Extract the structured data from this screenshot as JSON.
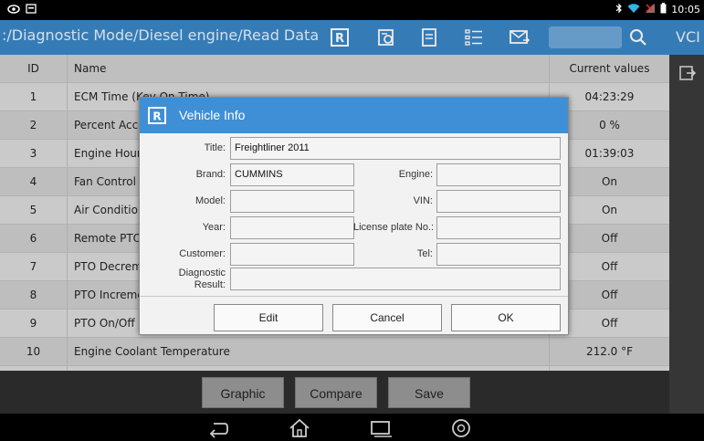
{
  "statusbar": {
    "left_icons": [
      "eye-icon",
      "screen-icon"
    ],
    "right_icons": [
      "bluetooth-icon",
      "wifi-icon",
      "signal-off-icon",
      "battery-icon"
    ],
    "time": "10:05"
  },
  "toolbar": {
    "path": ":/Diagnostic Mode/Diesel engine/Read Data Stre:",
    "icons": [
      "report-icon",
      "camera-icon",
      "save-file-icon",
      "list-icon",
      "mail-icon"
    ],
    "search_value": "",
    "vci_label": "VCI"
  },
  "table": {
    "headers": {
      "id": "ID",
      "name": "Name",
      "value": "Current values"
    },
    "rows": [
      {
        "id": "1",
        "name": "ECM Time (Key On Time)",
        "value": "04:23:29"
      },
      {
        "id": "2",
        "name": "Percent Acce",
        "value": "0 %"
      },
      {
        "id": "3",
        "name": "Engine Hours",
        "value": "01:39:03"
      },
      {
        "id": "4",
        "name": "Fan Control S",
        "value": "On"
      },
      {
        "id": "5",
        "name": "Air Conditioni",
        "value": "On"
      },
      {
        "id": "6",
        "name": "Remote PTO",
        "value": "Off"
      },
      {
        "id": "7",
        "name": "PTO Decrem",
        "value": "Off"
      },
      {
        "id": "8",
        "name": "PTO Increme",
        "value": "Off"
      },
      {
        "id": "9",
        "name": "PTO On/Off S",
        "value": "Off"
      },
      {
        "id": "10",
        "name": "Engine Coolant Temperature",
        "value": "212.0 °F"
      },
      {
        "id": "",
        "name": "",
        "value": ""
      }
    ]
  },
  "bottom_buttons": {
    "graphic": "Graphic",
    "compare": "Compare",
    "save": "Save"
  },
  "dialog": {
    "title": "Vehicle Info",
    "labels": {
      "title": "Title:",
      "brand": "Brand:",
      "engine": "Engine:",
      "model": "Model:",
      "vin": "VIN:",
      "year": "Year:",
      "license": "License plate No.:",
      "customer": "Customer:",
      "tel": "Tel:",
      "diagnostic": "Diagnostic",
      "diagnostic2": "Result:"
    },
    "values": {
      "title": "Freightliner 2011",
      "brand": "CUMMINS",
      "engine": "",
      "model": "",
      "vin": "",
      "year": "",
      "license": "",
      "customer": "",
      "tel": "",
      "diagnostic": ""
    },
    "buttons": {
      "edit": "Edit",
      "cancel": "Cancel",
      "ok": "OK"
    }
  },
  "colors": {
    "toolbar": "#3a87c7",
    "dialog_header": "#3f8fd6",
    "table_bg": "#d4d4d4"
  }
}
